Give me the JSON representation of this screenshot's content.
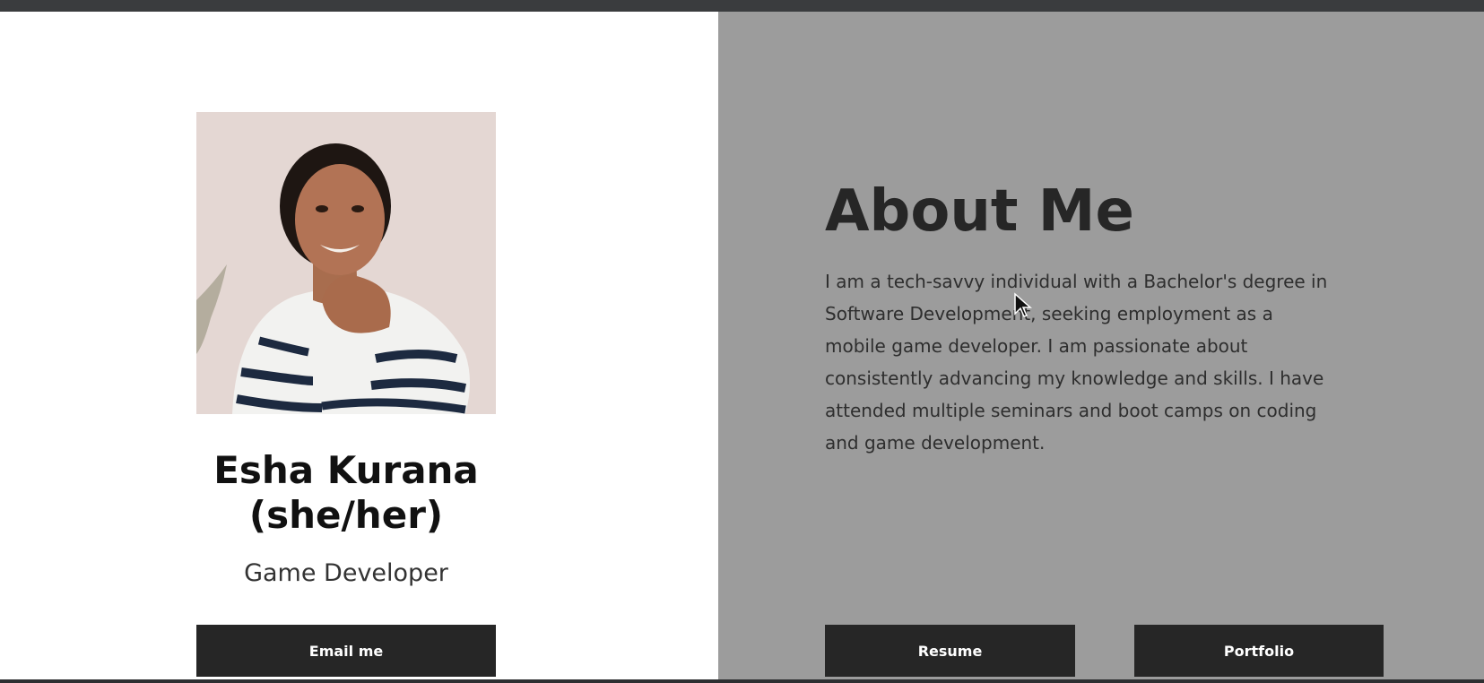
{
  "profile": {
    "name_line1": "Esha Kurana",
    "name_line2": "(she/her)",
    "role": "Game Developer",
    "email_label": "Email me",
    "photo_icon": "profile-photo"
  },
  "about": {
    "title": "About Me",
    "lines": [
      "I am a tech-savvy individual with a Bachelor's degree in",
      "Software Development, seeking employment as a",
      "mobile game developer. I am passionate about",
      "consistently advancing my knowledge and skills. I have",
      "attended multiple seminars and boot camps on coding",
      "and game development."
    ],
    "resume_label": "Resume",
    "portfolio_label": "Portfolio"
  },
  "colors": {
    "left_background": "#ffffff",
    "right_background": "#9c9c9c",
    "button_background": "#262626",
    "chrome": "#2d2f31"
  }
}
